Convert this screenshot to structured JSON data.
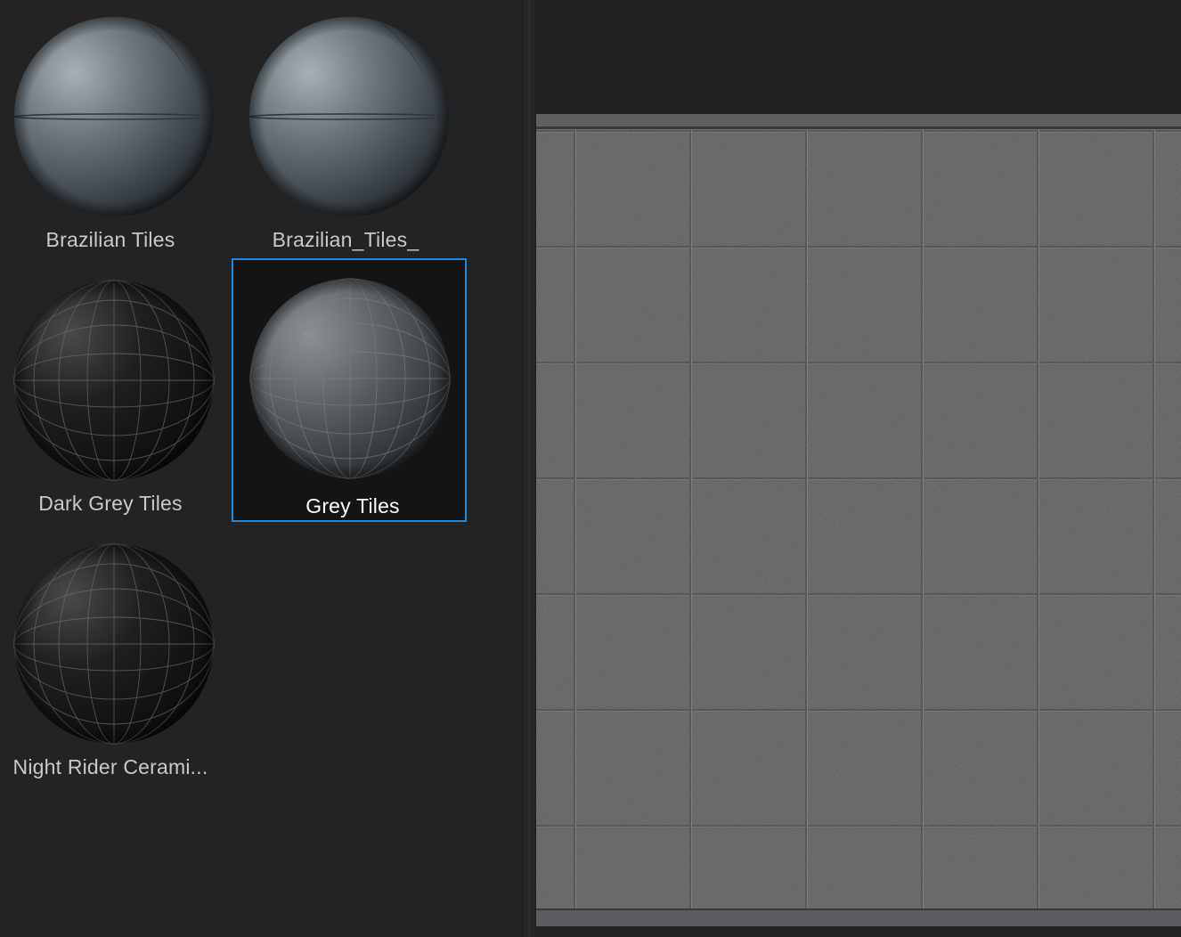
{
  "materials": [
    {
      "label": "Brazilian Tiles",
      "icon": "sphere-brazilian-tiles-icon",
      "selected": false
    },
    {
      "label": "Brazilian_Tiles_",
      "icon": "sphere-brazilian-tiles-copy-icon",
      "selected": false
    },
    {
      "label": "Dark Grey Tiles",
      "icon": "sphere-dark-grey-tiles-icon",
      "selected": false
    },
    {
      "label": "Grey Tiles",
      "icon": "sphere-grey-tiles-icon",
      "selected": true
    },
    {
      "label": "Night Rider Cerami...",
      "icon": "sphere-night-rider-ceramic-icon",
      "selected": false
    }
  ],
  "colors": {
    "selection_border": "#1e88e5",
    "panel_background": "#232323",
    "tile_surface": "#58595a",
    "grout": "#3a3a3a"
  }
}
